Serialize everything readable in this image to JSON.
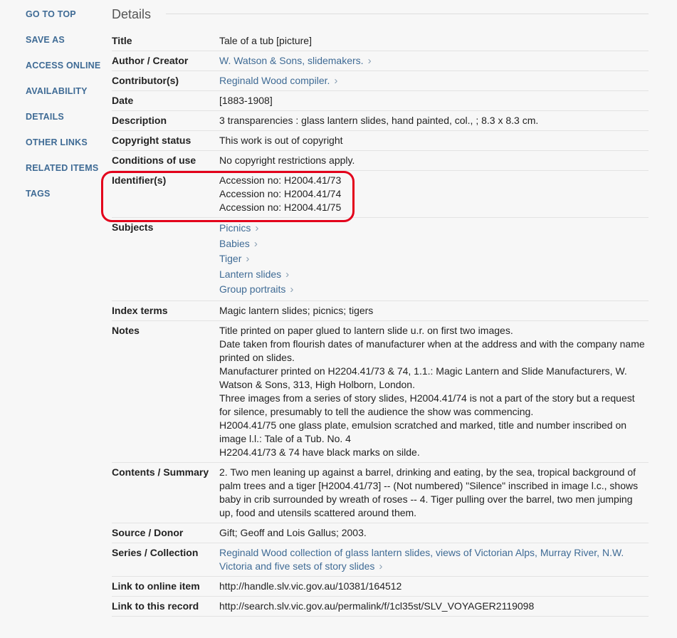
{
  "sidebar": {
    "items": [
      {
        "label": "GO TO TOP"
      },
      {
        "label": "SAVE AS"
      },
      {
        "label": "ACCESS ONLINE"
      },
      {
        "label": "AVAILABILITY"
      },
      {
        "label": "DETAILS"
      },
      {
        "label": "OTHER LINKS"
      },
      {
        "label": "RELATED ITEMS"
      },
      {
        "label": "TAGS"
      }
    ]
  },
  "details": {
    "heading": "Details",
    "title_label": "Title",
    "title_value": "Tale of a tub [picture]",
    "author_label": "Author / Creator",
    "author_value": "W. Watson & Sons, slidemakers.",
    "contributor_label": "Contributor(s)",
    "contributor_value": "Reginald Wood compiler.",
    "date_label": "Date",
    "date_value": "[1883-1908]",
    "description_label": "Description",
    "description_value": "3 transparencies : glass lantern slides, hand painted, col., ; 8.3 x 8.3 cm.",
    "copyright_label": "Copyright status",
    "copyright_value": "This work is out of copyright",
    "conditions_label": "Conditions of use",
    "conditions_value": "No copyright restrictions apply.",
    "identifiers_label": "Identifier(s)",
    "identifiers": [
      "Accession no: H2004.41/73",
      "Accession no: H2004.41/74",
      "Accession no: H2004.41/75"
    ],
    "subjects_label": "Subjects",
    "subjects": [
      "Picnics",
      "Babies",
      "Tiger",
      "Lantern slides",
      "Group portraits"
    ],
    "index_label": "Index terms",
    "index_value": "Magic lantern slides; picnics; tigers",
    "notes_label": "Notes",
    "notes": [
      "Title printed on paper glued to lantern slide u.r. on first two images.",
      "Date taken from flourish dates of manufacturer when at the address and with the company name printed on slides.",
      "Manufacturer printed on H2204.41/73 & 74, 1.1.: Magic Lantern and Slide Manufacturers, W. Watson & Sons, 313, High Holborn, London.",
      "Three images from a series of story slides, H2004.41/74 is not a part of the story but a request for silence, presumably to tell the audience the show was commencing.",
      "H2004.41/75 one glass plate, emulsion scratched and marked, title and number inscribed on image l.l.: Tale of a Tub. No. 4",
      "H2204.41/73 & 74 have black marks on silde."
    ],
    "contents_label": "Contents / Summary",
    "contents_value": "2. Two men leaning up against a barrel, drinking and eating, by the sea, tropical background of palm trees and a tiger [H2004.41/73] -- (Not numbered) \"Silence\" inscribed in image l.c., shows baby in crib surrounded by wreath of roses -- 4. Tiger pulling over the barrel, two men jumping up, food and utensils scattered around them.",
    "source_label": "Source / Donor",
    "source_value": "Gift; Geoff and Lois Gallus; 2003.",
    "series_label": "Series / Collection",
    "series_value": "Reginald Wood collection of glass lantern slides, views of Victorian Alps, Murray River, N.W. Victoria and five sets of story slides",
    "online_label": "Link to online item",
    "online_value": "http://handle.slv.vic.gov.au/10381/164512",
    "record_label": "Link to this record",
    "record_value": "http://search.slv.vic.gov.au/permalink/f/1cl35st/SLV_VOYAGER2119098"
  },
  "colors": {
    "link": "#3f6b95",
    "highlight": "#e3001b"
  },
  "icons": {
    "chevron": "chevron-right-icon"
  }
}
